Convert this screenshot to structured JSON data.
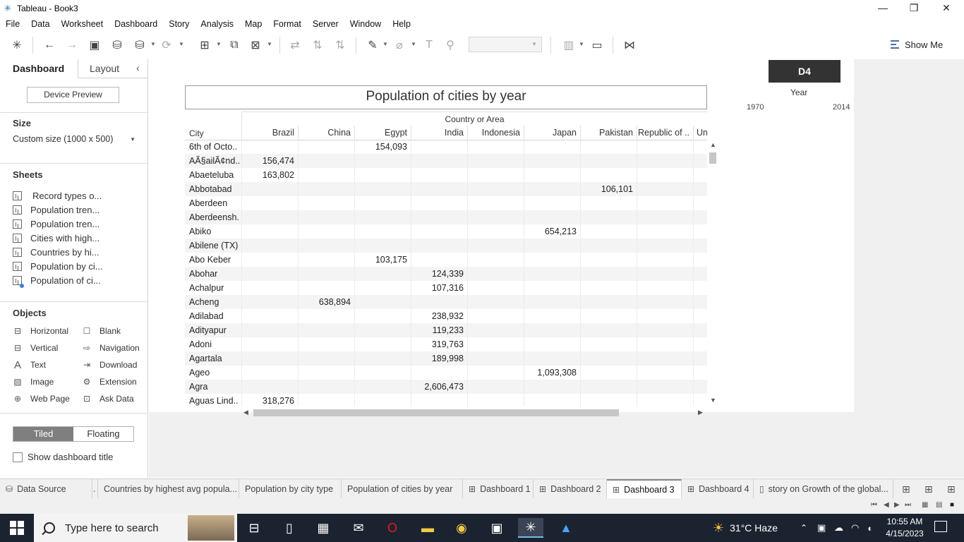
{
  "window": {
    "title": "Tableau - Book3",
    "minimize": "—",
    "restore": "❐",
    "close": "✕"
  },
  "menu": [
    "File",
    "Data",
    "Worksheet",
    "Dashboard",
    "Story",
    "Analysis",
    "Map",
    "Format",
    "Server",
    "Window",
    "Help"
  ],
  "toolbar": {
    "show_me": "Show Me"
  },
  "left_panel": {
    "tabs": {
      "dashboard": "Dashboard",
      "layout": "Layout"
    },
    "device_preview": "Device Preview",
    "size_heading": "Size",
    "size_value": "Custom size (1000 x 500)",
    "sheets_heading": "Sheets",
    "sheets": [
      "Record types o...",
      "Population tren...",
      "Population tren...",
      "Cities with high...",
      "Countries by hi...",
      "Population by ci...",
      "Population of ci..."
    ],
    "objects_heading": "Objects",
    "objects": [
      {
        "label": "Horizontal",
        "icon": "horizontal-icon"
      },
      {
        "label": "Blank",
        "icon": "blank-icon"
      },
      {
        "label": "Vertical",
        "icon": "vertical-icon"
      },
      {
        "label": "Navigation",
        "icon": "navigation-icon"
      },
      {
        "label": "Text",
        "icon": "text-icon"
      },
      {
        "label": "Download",
        "icon": "download-icon"
      },
      {
        "label": "Image",
        "icon": "image-icon"
      },
      {
        "label": "Extension",
        "icon": "extension-icon"
      },
      {
        "label": "Web Page",
        "icon": "web-page-icon"
      },
      {
        "label": "Ask Data",
        "icon": "ask-data-icon"
      }
    ],
    "tiled": "Tiled",
    "floating": "Floating",
    "show_title": "Show dashboard title"
  },
  "viz": {
    "title": "Population of cities by year",
    "column_group": "Country or Area",
    "row_header": "City",
    "columns": [
      "Brazil",
      "China",
      "Egypt",
      "India",
      "Indonesia",
      "Japan",
      "Pakistan",
      "Republic of ..",
      "Un"
    ],
    "rows": [
      {
        "city": "6th of Octo..",
        "values": [
          "",
          "",
          "154,093",
          "",
          "",
          "",
          "",
          "",
          ""
        ]
      },
      {
        "city": "AÃ§ailÃ¢nd..",
        "values": [
          "156,474",
          "",
          "",
          "",
          "",
          "",
          "",
          "",
          ""
        ]
      },
      {
        "city": "Abaeteluba",
        "values": [
          "163,802",
          "",
          "",
          "",
          "",
          "",
          "",
          "",
          ""
        ]
      },
      {
        "city": "Abbotabad",
        "values": [
          "",
          "",
          "",
          "",
          "",
          "",
          "106,101",
          "",
          ""
        ]
      },
      {
        "city": "Aberdeen",
        "values": [
          "",
          "",
          "",
          "",
          "",
          "",
          "",
          "",
          ""
        ]
      },
      {
        "city": "Aberdeensh..",
        "values": [
          "",
          "",
          "",
          "",
          "",
          "",
          "",
          "",
          ""
        ]
      },
      {
        "city": "Abiko",
        "values": [
          "",
          "",
          "",
          "",
          "",
          "654,213",
          "",
          "",
          ""
        ]
      },
      {
        "city": "Abilene (TX)",
        "values": [
          "",
          "",
          "",
          "",
          "",
          "",
          "",
          "",
          ""
        ]
      },
      {
        "city": "Abo Keber",
        "values": [
          "",
          "",
          "103,175",
          "",
          "",
          "",
          "",
          "",
          ""
        ]
      },
      {
        "city": "Abohar",
        "values": [
          "",
          "",
          "",
          "124,339",
          "",
          "",
          "",
          "",
          ""
        ]
      },
      {
        "city": "Achalpur",
        "values": [
          "",
          "",
          "",
          "107,316",
          "",
          "",
          "",
          "",
          ""
        ]
      },
      {
        "city": "Acheng",
        "values": [
          "",
          "638,894",
          "",
          "",
          "",
          "",
          "",
          "",
          ""
        ]
      },
      {
        "city": "Adilabad",
        "values": [
          "",
          "",
          "",
          "238,932",
          "",
          "",
          "",
          "",
          ""
        ]
      },
      {
        "city": "Adityapur",
        "values": [
          "",
          "",
          "",
          "119,233",
          "",
          "",
          "",
          "",
          ""
        ]
      },
      {
        "city": "Adoni",
        "values": [
          "",
          "",
          "",
          "319,763",
          "",
          "",
          "",
          "",
          ""
        ]
      },
      {
        "city": "Agartala",
        "values": [
          "",
          "",
          "",
          "189,998",
          "",
          "",
          "",
          "",
          ""
        ]
      },
      {
        "city": "Ageo",
        "values": [
          "",
          "",
          "",
          "",
          "",
          "1,093,308",
          "",
          "",
          ""
        ]
      },
      {
        "city": "Agra",
        "values": [
          "",
          "",
          "",
          "2,606,473",
          "",
          "",
          "",
          "",
          ""
        ]
      },
      {
        "city": "Aguas Lind..",
        "values": [
          "318,276",
          "",
          "",
          "",
          "",
          "",
          "",
          "",
          ""
        ]
      }
    ]
  },
  "filter": {
    "header": "D4",
    "label": "Year",
    "min": "1970",
    "max": "2014"
  },
  "sheet_tabs": [
    {
      "label": "Data Source",
      "icon": "data-source-icon"
    },
    {
      "label": ".",
      "icon": ""
    },
    {
      "label": "Countries by highest avg popula...",
      "icon": ""
    },
    {
      "label": "Population by city type",
      "icon": ""
    },
    {
      "label": "Population of cities by year",
      "icon": ""
    },
    {
      "label": "Dashboard 1",
      "icon": "dashboard-icon"
    },
    {
      "label": "Dashboard 2",
      "icon": "dashboard-icon"
    },
    {
      "label": "Dashboard 3",
      "icon": "dashboard-icon"
    },
    {
      "label": "Dashboard 4",
      "icon": "dashboard-icon"
    },
    {
      "label": "story on Growth of the global...",
      "icon": "story-icon"
    }
  ],
  "taskbar": {
    "search_placeholder": "Type here to search",
    "weather": "31°C  Haze",
    "time": "10:55 AM",
    "date": "4/15/2023"
  }
}
